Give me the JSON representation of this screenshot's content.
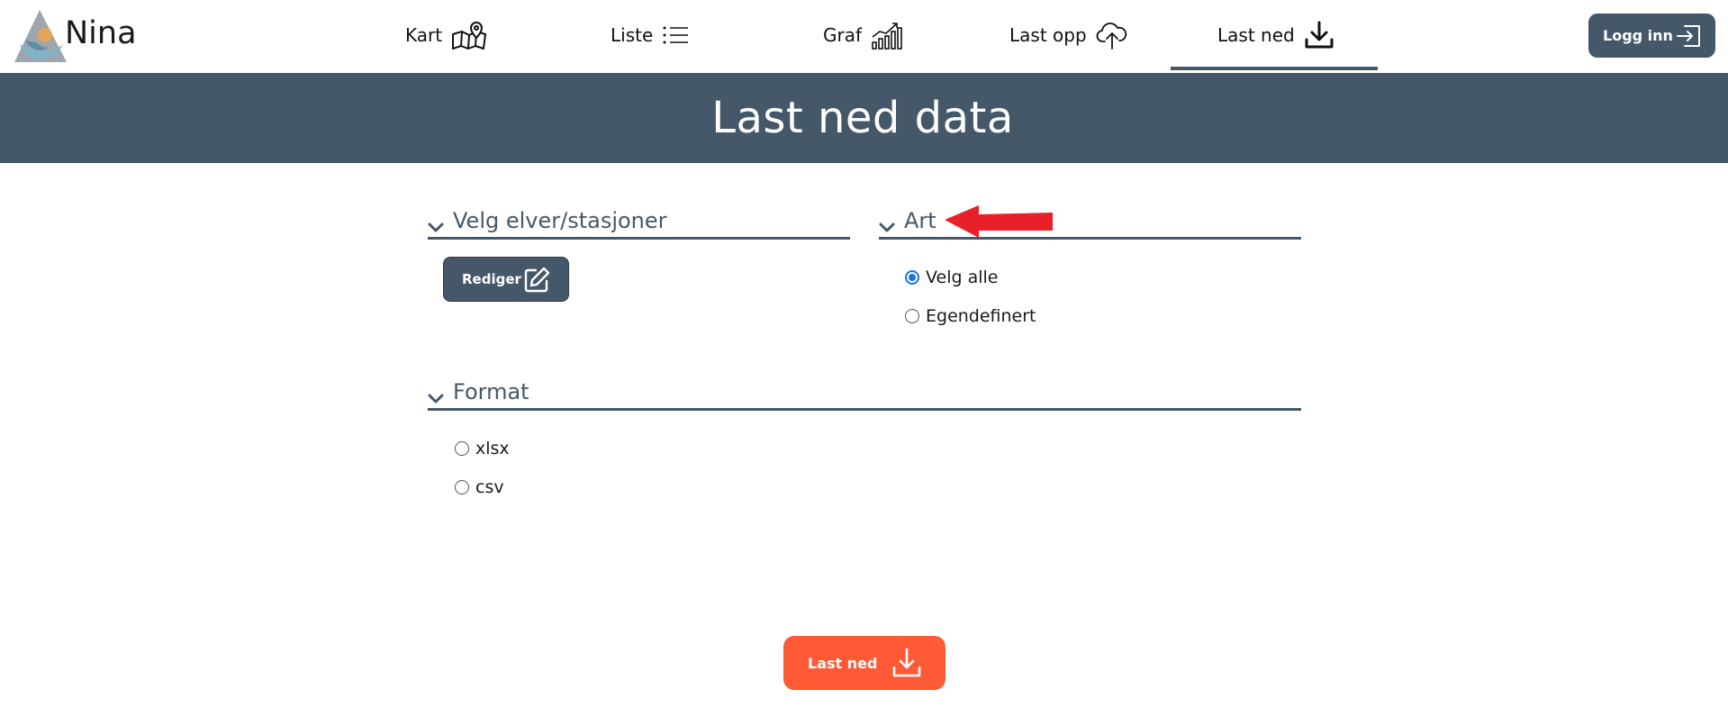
{
  "brand": {
    "name": "Nina"
  },
  "nav": {
    "items": [
      {
        "label": "Kart",
        "icon": "map-icon"
      },
      {
        "label": "Liste",
        "icon": "list-icon"
      },
      {
        "label": "Graf",
        "icon": "chart-icon"
      },
      {
        "label": "Last opp",
        "icon": "cloud-upload-icon"
      },
      {
        "label": "Last ned",
        "icon": "download-icon",
        "active": true
      }
    ],
    "login_label": "Logg inn"
  },
  "page": {
    "title": "Last ned data"
  },
  "sections": {
    "stations": {
      "title": "Velg elver/stasjoner",
      "edit_label": "Rediger"
    },
    "species": {
      "title": "Art",
      "options": [
        {
          "label": "Velg alle",
          "checked": true
        },
        {
          "label": "Egendefinert",
          "checked": false
        }
      ]
    },
    "format": {
      "title": "Format",
      "options": [
        {
          "label": "xlsx",
          "checked": false
        },
        {
          "label": "csv",
          "checked": false
        }
      ]
    }
  },
  "download_button": {
    "label": "Last ned"
  },
  "colors": {
    "primary": "#455869",
    "accent": "#ff5a36",
    "radio_checked": "#1a73e8",
    "annotation_arrow": "#e8202a"
  }
}
